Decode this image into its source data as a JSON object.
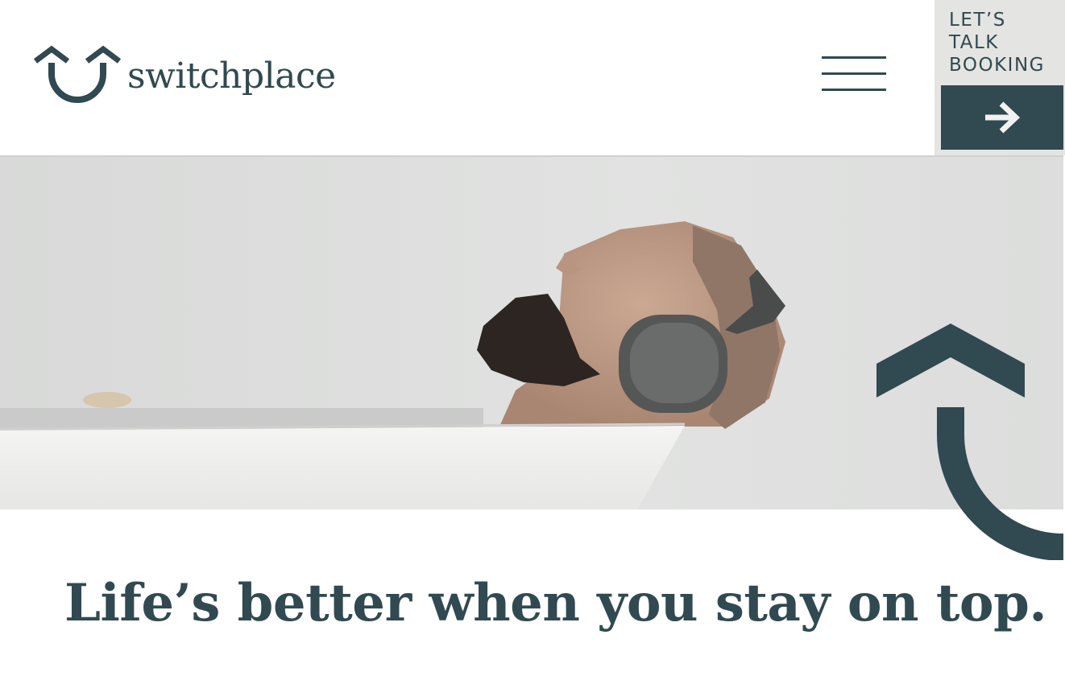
{
  "brand": {
    "name": "switchplace",
    "color": "#314950"
  },
  "header": {
    "menu_icon": "hamburger-menu-icon",
    "cta": {
      "lines": [
        "LET’S",
        "TALK",
        "BOOKING"
      ],
      "arrow_icon": "arrow-right-icon",
      "background": "#e4e4e2"
    }
  },
  "hero": {
    "image": "man-with-headphones-relaxing-in-bathtub"
  },
  "main": {
    "headline": "Life’s better when you stay on top."
  }
}
